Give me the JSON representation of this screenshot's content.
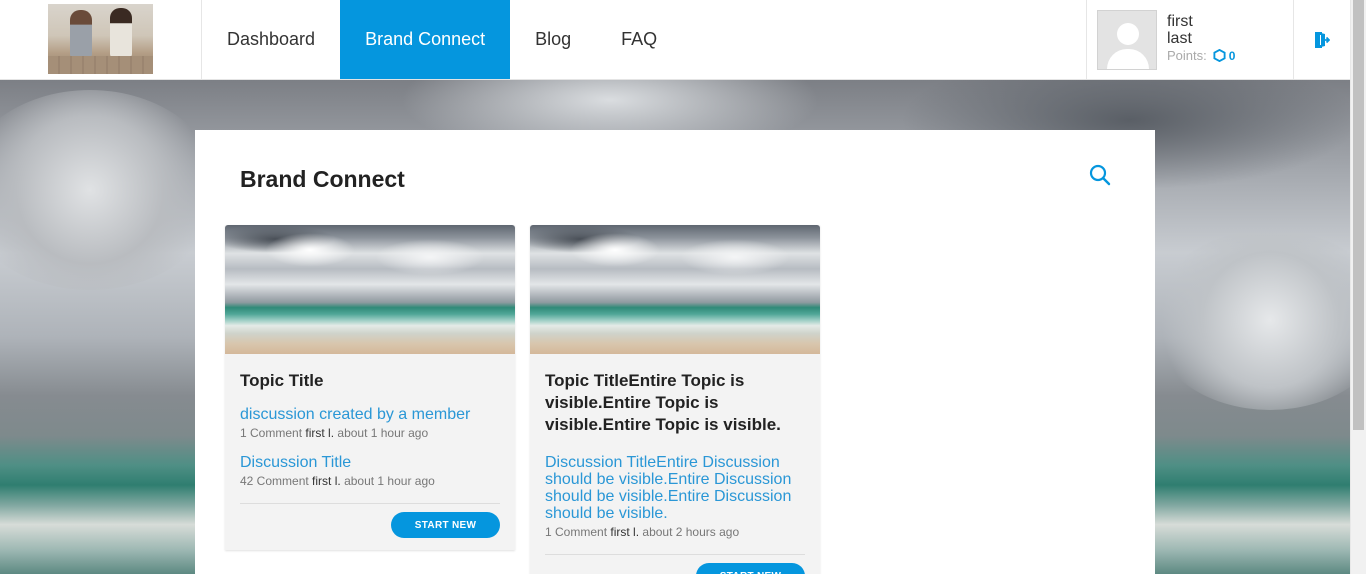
{
  "nav": {
    "items": [
      {
        "label": "Dashboard",
        "active": false
      },
      {
        "label": "Brand Connect",
        "active": true
      },
      {
        "label": "Blog",
        "active": false
      },
      {
        "label": "FAQ",
        "active": false
      }
    ]
  },
  "user": {
    "first": "first",
    "last": "last",
    "points_label": "Points:",
    "points_value": "0"
  },
  "page": {
    "title": "Brand Connect"
  },
  "cards": [
    {
      "topic_title": "Topic Title",
      "discussions": [
        {
          "title": "discussion created by a member",
          "comments": "1 Comment",
          "author": "first l.",
          "time": "about 1 hour ago"
        },
        {
          "title": "Discussion Title",
          "comments": "42 Comment",
          "author": "first l.",
          "time": "about 1 hour ago"
        }
      ],
      "button_label": "START NEW"
    },
    {
      "topic_title": "Topic TitleEntire Topic is visible.Entire Topic is visible.Entire Topic is visible.",
      "discussions": [
        {
          "title": "Discussion TitleEntire Discussion should be visible.Entire Discussion should be visible.Entire Discussion should be visible.",
          "comments": "1 Comment",
          "author": "first l.",
          "time": "about 2 hours ago"
        }
      ],
      "button_label": "START NEW"
    }
  ],
  "colors": {
    "accent": "#0596de",
    "link": "#2a97d6"
  },
  "icons": {
    "search": "search-icon",
    "logout": "logout-icon",
    "points": "hexagon-icon"
  }
}
